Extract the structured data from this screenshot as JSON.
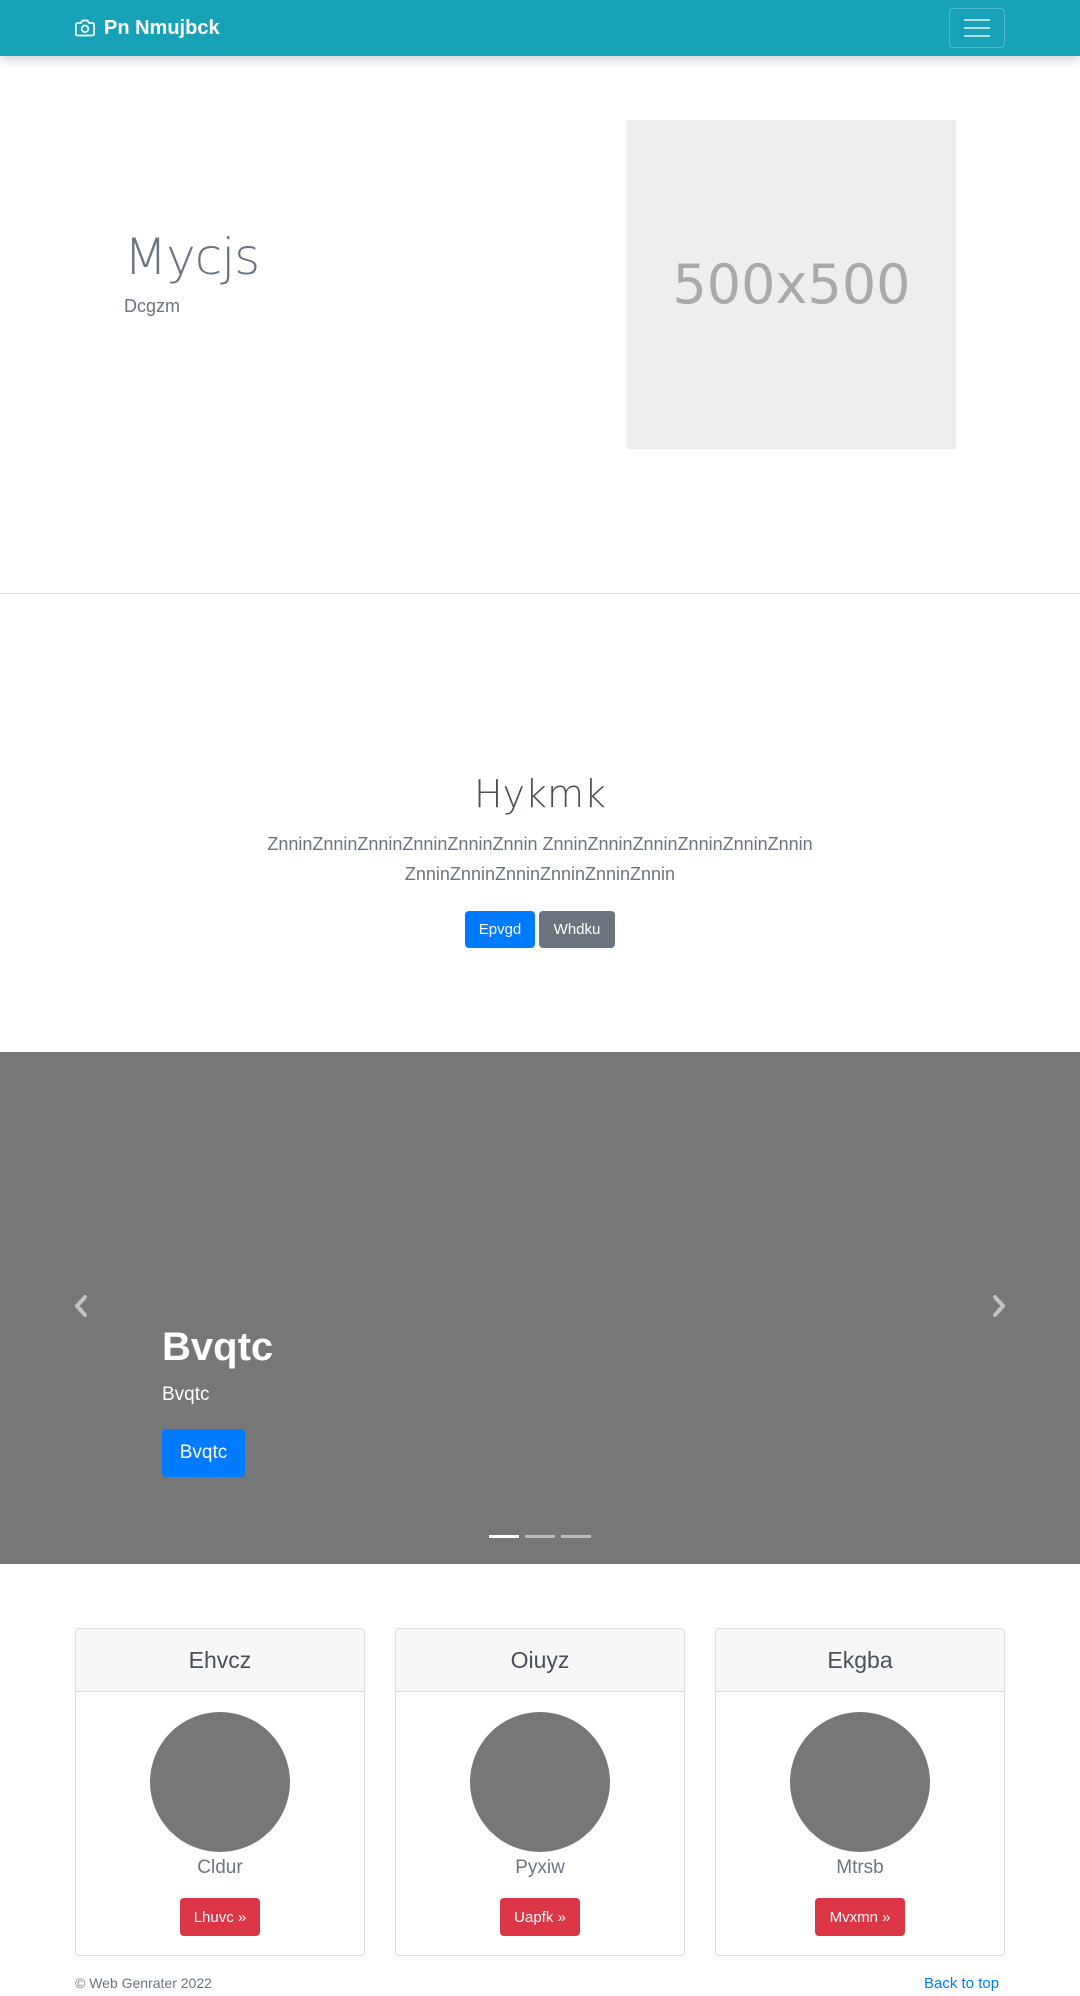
{
  "navbar": {
    "brand": "Pn Nmujbck",
    "brand_icon": "camera-icon",
    "toggler_icon": "hamburger-icon",
    "background": "#17a2b8"
  },
  "hero": {
    "title": "Mycjs",
    "subtitle": "Dcgzm",
    "image_label": "500x500"
  },
  "section": {
    "title": "Hykmk",
    "text": "ZnninZnninZnninZnninZnninZnnin ZnninZnninZnninZnninZnninZnnin ZnninZnninZnninZnninZnninZnnin",
    "primary_button": "Epvgd",
    "secondary_button": "Whdku"
  },
  "carousel": {
    "title": "Bvqtc",
    "subtitle": "Bvqtc",
    "button": "Bvqtc",
    "prev_icon": "chevron-left-icon",
    "next_icon": "chevron-right-icon",
    "slides": 3,
    "active_slide": 1
  },
  "cards": [
    {
      "title": "Ehvcz",
      "name": "Cldur",
      "button": "Lhuvc »"
    },
    {
      "title": "Oiuyz",
      "name": "Pyxiw",
      "button": "Uapfk »"
    },
    {
      "title": "Ekgba",
      "name": "Mtrsb",
      "button": "Mvxmn »"
    }
  ],
  "footer": {
    "copyright": "© Web Genrater 2022",
    "back_to_top": "Back to top"
  },
  "colors": {
    "primary": "#007bff",
    "secondary": "#6c757d",
    "danger": "#dc3545",
    "info": "#17a2b8"
  }
}
